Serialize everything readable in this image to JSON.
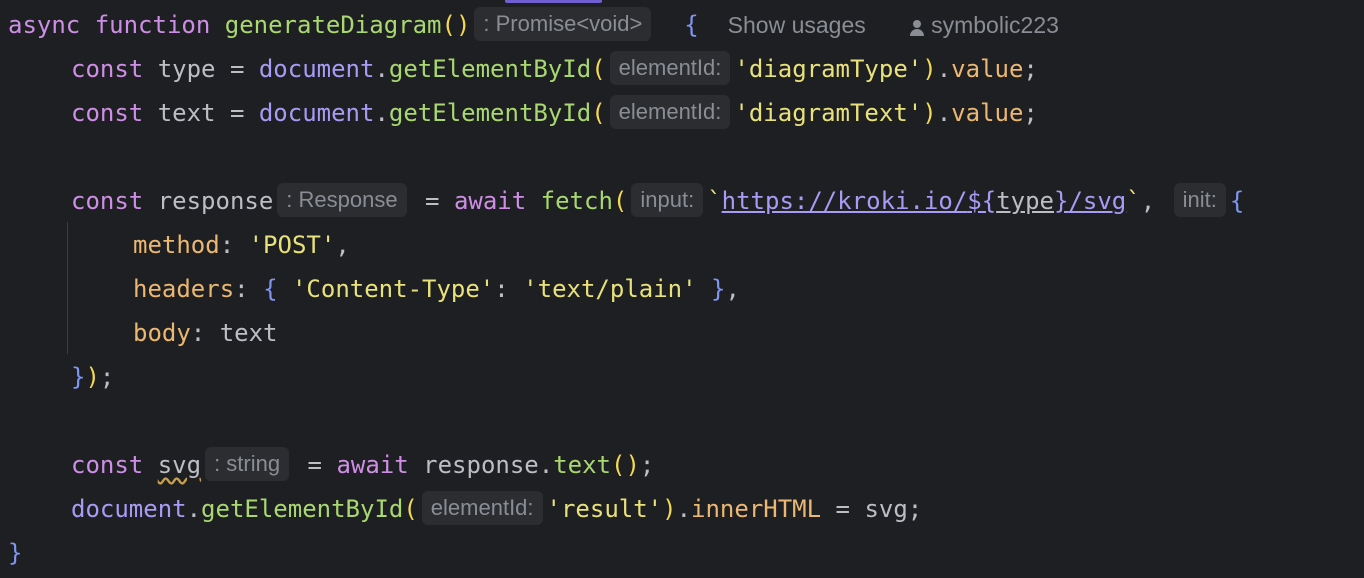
{
  "code": {
    "line1": {
      "kw_async": "async",
      "kw_function": "function",
      "fn_name": "generateDiagram",
      "parens": "()",
      "return_hint": ": Promise<void>",
      "brace": "{",
      "show_usages": "Show usages",
      "author": "symbolic223"
    },
    "line2": {
      "kw": "const",
      "var": "type",
      "eq": "=",
      "obj": "document",
      "dot": ".",
      "method": "getElementById",
      "open": "(",
      "param_hint": "elementId:",
      "arg": "'diagramType'",
      "close": ")",
      "dot2": ".",
      "prop": "value",
      "semi": ";"
    },
    "line3": {
      "kw": "const",
      "var": "text",
      "eq": "=",
      "obj": "document",
      "dot": ".",
      "method": "getElementById",
      "open": "(",
      "param_hint": "elementId:",
      "arg": "'diagramText'",
      "close": ")",
      "dot2": ".",
      "prop": "value",
      "semi": ";"
    },
    "line5": {
      "kw": "const",
      "var": "response",
      "type_hint": ": Response",
      "eq": "=",
      "await": "await",
      "fn": "fetch",
      "open": "(",
      "input_hint": "input:",
      "tick_open": "`",
      "url_start": "https://kroki.io/",
      "tpl_open": "${",
      "tpl_var": "type",
      "tpl_close": "}",
      "url_end": "/svg",
      "tick_close": "`",
      "comma": ",",
      "init_hint": "init:",
      "brace": "{"
    },
    "line6": {
      "key": "method",
      "colon": ":",
      "val": "'POST'",
      "comma": ","
    },
    "line7": {
      "key": "headers",
      "colon": ":",
      "open": "{",
      "hkey": "'Content-Type'",
      "colon2": ":",
      "hval": "'text/plain'",
      "close": "}",
      "comma": ","
    },
    "line8": {
      "key": "body",
      "colon": ":",
      "val": "text"
    },
    "line9": {
      "brace": "}",
      "paren": ")",
      "semi": ";"
    },
    "line11": {
      "kw": "const",
      "var": "svg",
      "type_hint": ": string",
      "eq": "=",
      "await": "await",
      "obj": "response",
      "dot": ".",
      "method": "text",
      "parens": "()",
      "semi": ";"
    },
    "line12": {
      "obj": "document",
      "dot": ".",
      "method": "getElementById",
      "open": "(",
      "param_hint": "elementId:",
      "arg": "'result'",
      "close": ")",
      "dot2": ".",
      "prop": "innerHTML",
      "eq": "=",
      "val": "svg",
      "semi": ";"
    },
    "line13": {
      "brace": "}"
    }
  }
}
